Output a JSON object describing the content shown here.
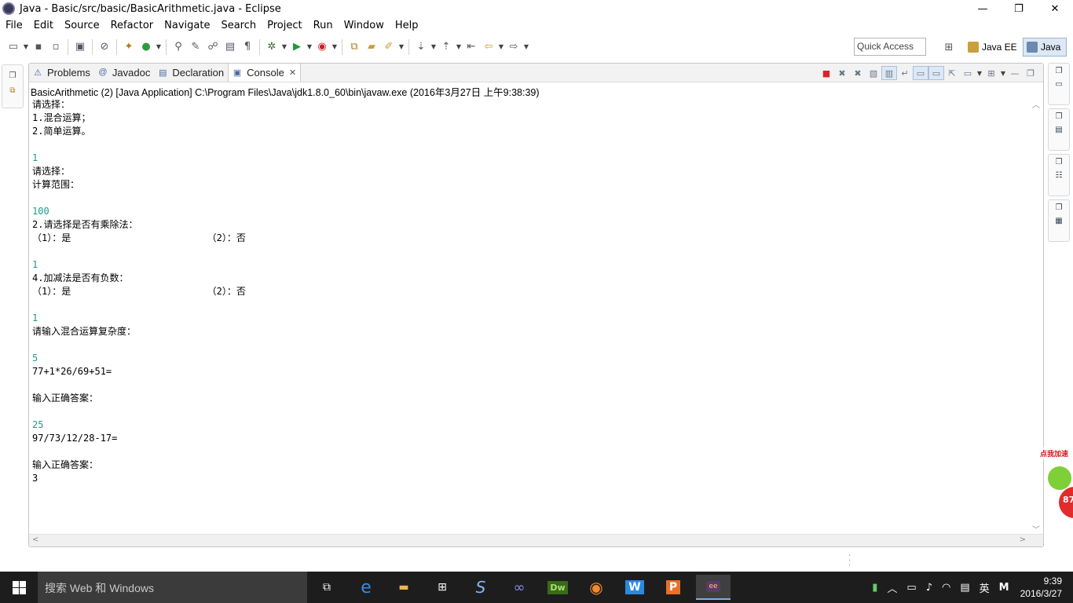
{
  "window": {
    "title": "Java - Basic/src/basic/BasicArithmetic.java - Eclipse",
    "controls": [
      "—",
      "❐",
      "✕"
    ]
  },
  "menu": [
    "File",
    "Edit",
    "Source",
    "Refactor",
    "Navigate",
    "Search",
    "Project",
    "Run",
    "Window",
    "Help"
  ],
  "toolbar": {
    "quick_access_placeholder": "Quick Access",
    "perspectives": [
      "Java EE",
      "Java"
    ]
  },
  "view": {
    "tabs": [
      {
        "label": "Problems",
        "icon": "problems-icon"
      },
      {
        "label": "Javadoc",
        "icon": "javadoc-icon"
      },
      {
        "label": "Declaration",
        "icon": "declaration-icon"
      },
      {
        "label": "Console",
        "icon": "console-icon",
        "active": true
      }
    ],
    "console_header": "BasicArithmetic (2) [Java Application] C:\\Program Files\\Java\\jdk1.8.0_60\\bin\\javaw.exe (2016年3月27日 上午9:38:39)",
    "console_lines": [
      {
        "text": "请选择：",
        "input": false
      },
      {
        "text": "1.混合运算；",
        "input": false
      },
      {
        "text": "2.简单运算。",
        "input": false
      },
      {
        "text": "",
        "input": false
      },
      {
        "text": "1",
        "input": true
      },
      {
        "text": "请选择：",
        "input": false
      },
      {
        "text": "计算范围：",
        "input": false
      },
      {
        "text": "",
        "input": false
      },
      {
        "text": "100",
        "input": true
      },
      {
        "text": "2.请选择是否有乘除法：",
        "input": false
      },
      {
        "text": "（1）：是                        （2）：否",
        "input": false
      },
      {
        "text": "",
        "input": false
      },
      {
        "text": "1",
        "input": true
      },
      {
        "text": "4.加减法是否有负数：",
        "input": false
      },
      {
        "text": "（1）：是                        （2）：否",
        "input": false
      },
      {
        "text": "",
        "input": false
      },
      {
        "text": "1",
        "input": true
      },
      {
        "text": "请输入混合运算复杂度：",
        "input": false
      },
      {
        "text": "",
        "input": false
      },
      {
        "text": "5",
        "input": true
      },
      {
        "text": "77+1*26/69+51=",
        "input": false
      },
      {
        "text": "",
        "input": false
      },
      {
        "text": "输入正确答案：",
        "input": false
      },
      {
        "text": "",
        "input": false
      },
      {
        "text": "25",
        "input": true
      },
      {
        "text": "97/73/12/28-17=",
        "input": false
      },
      {
        "text": "",
        "input": false
      },
      {
        "text": "输入正确答案：",
        "input": false
      },
      {
        "text": "3",
        "input": false
      }
    ]
  },
  "widget": {
    "label": "点我加速",
    "value": "87"
  },
  "taskbar": {
    "search_placeholder": "搜索 Web 和 Windows",
    "ime": "英",
    "ime2": "M",
    "time": "9:39",
    "date": "2016/3/27",
    "apps": [
      "task-view-icon",
      "edge-icon",
      "explorer-icon",
      "store-icon",
      "s-app-icon",
      "infinity-app-icon",
      "dreamweaver-icon",
      "browser-icon",
      "wps-writer-icon",
      "wps-presentation-icon",
      "eclipse-icon"
    ]
  },
  "colors": {
    "console_input": "#1f9b8a",
    "taskbar_bg": "#1d1d1d",
    "search_bg": "#3b3b3b"
  }
}
